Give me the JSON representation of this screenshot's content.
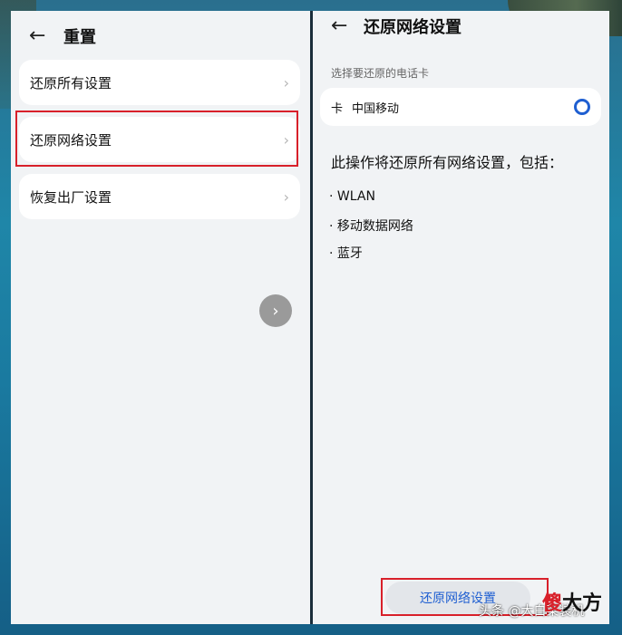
{
  "left": {
    "title": "重置",
    "back_icon": "arrow-left-icon",
    "items": [
      {
        "label": "还原所有设置"
      },
      {
        "label": "还原网络设置"
      },
      {
        "label": "恢复出厂设置"
      }
    ],
    "fab_icon": "chevron-right-icon"
  },
  "right": {
    "title": "还原网络设置",
    "back_icon": "arrow-left-icon",
    "select_label": "选择要还原的电话卡",
    "sim": {
      "card": "卡",
      "operator": "中国移动",
      "selected": true
    },
    "description": "此操作将还原所有网络设置，包括：",
    "bullets": [
      "· WLAN",
      "· 移动数据网络",
      "· 蓝牙"
    ],
    "button_label": "还原网络设置"
  },
  "watermark": {
    "text": "头条 @大白菜装机",
    "logo_red": "傻",
    "logo_black": "大方"
  },
  "colors": {
    "accent": "#1f5fd1",
    "highlight": "#d8202a"
  }
}
